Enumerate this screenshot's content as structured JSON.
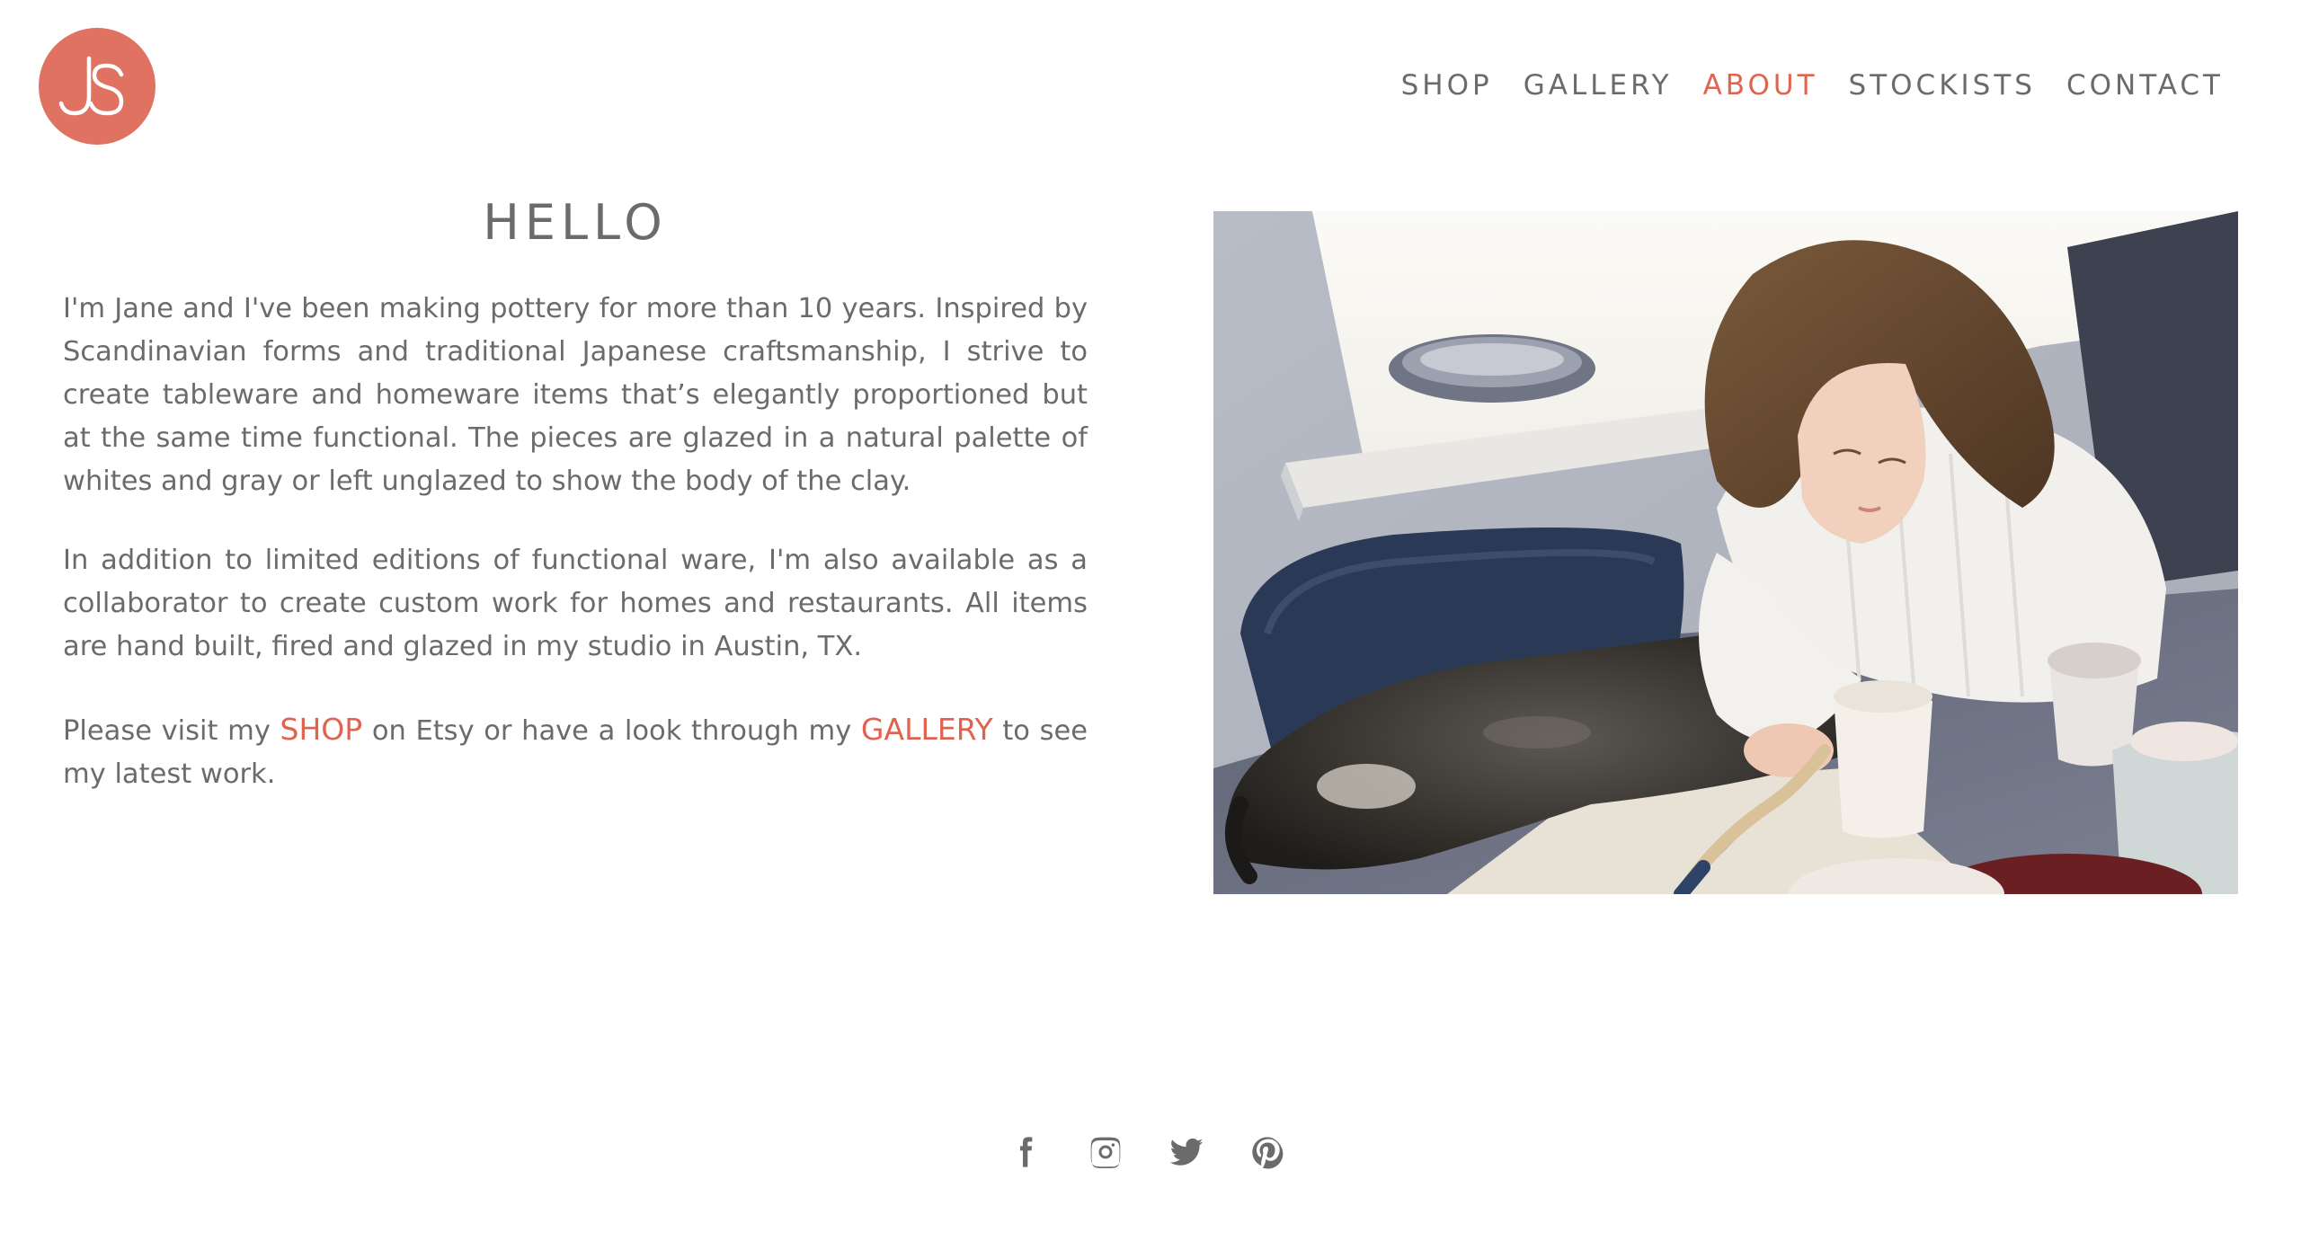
{
  "logo": {
    "text": "JS",
    "color": "#e07262"
  },
  "nav": {
    "items": [
      {
        "label": "SHOP"
      },
      {
        "label": "GALLERY"
      },
      {
        "label": "ABOUT",
        "active": true
      },
      {
        "label": "STOCKISTS"
      },
      {
        "label": "CONTACT"
      }
    ],
    "active_color": "#e0634f"
  },
  "main": {
    "heading": "HELLO",
    "paragraph1": "I'm Jane and I've been making pottery for more than 10 years. Inspired by Scandinavian forms and traditional Japanese craftsmanship, I strive to create tableware and homeware items that’s elegantly proportioned but at the same time functional. The pieces are glazed in a natural palette of whites and gray or left unglazed to show the body of the clay.",
    "paragraph2": "In addition to limited editions of functional ware, I'm also available as a collaborator to create custom work for homes and restaurants. All items are hand built, fired and glazed in my studio in Austin, TX.",
    "paragraph3": {
      "part1": "Please visit my ",
      "shop_link": "SHOP",
      "part2": " on Etsy or have a look through my ",
      "gallery_link": "GALLERY",
      "part3": " to see my latest work."
    }
  },
  "photo": {
    "icon": "pottery-studio-photo"
  },
  "social": {
    "icons": [
      "facebook-icon",
      "instagram-icon",
      "twitter-icon",
      "pinterest-icon"
    ]
  }
}
